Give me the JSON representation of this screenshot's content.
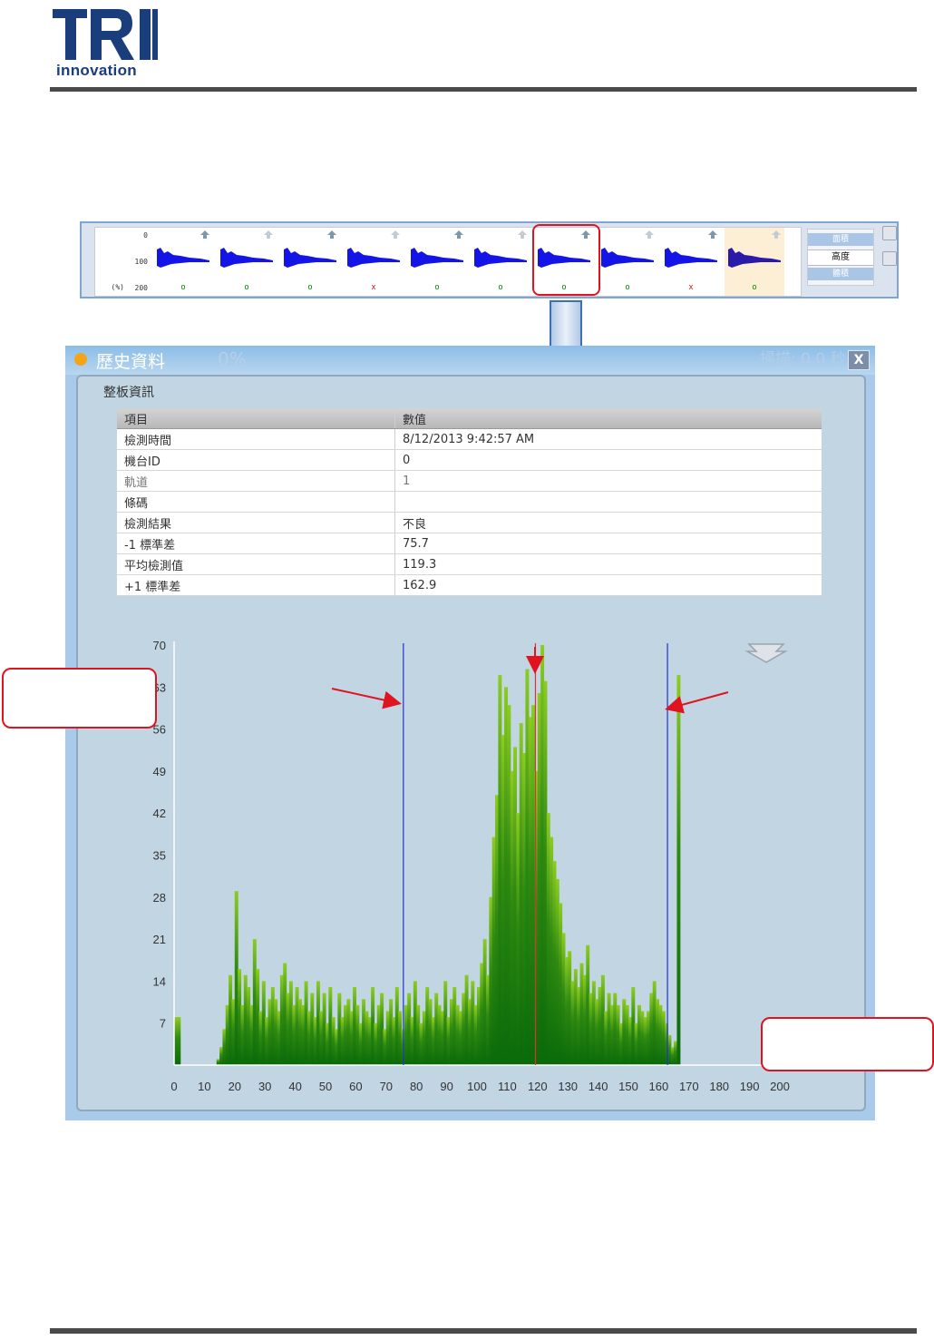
{
  "logo": {
    "brand": "TRI",
    "tagline": "innovation"
  },
  "strip": {
    "y_labels": [
      "0",
      "100",
      "(%)",
      "200"
    ],
    "thumbs": [
      {
        "mark": "o",
        "result": "ok"
      },
      {
        "mark": "o",
        "result": "ok"
      },
      {
        "mark": "o",
        "result": "ok"
      },
      {
        "mark": "x",
        "result": "ng"
      },
      {
        "mark": "o",
        "result": "ok"
      },
      {
        "mark": "o",
        "result": "ok"
      },
      {
        "mark": "o",
        "result": "ok"
      },
      {
        "mark": "o",
        "result": "ok"
      },
      {
        "mark": "x",
        "result": "ng"
      },
      {
        "mark": "o",
        "result": "ok"
      }
    ],
    "side_top": "面積",
    "side_selected": "高度",
    "side_bottom": "體積"
  },
  "window": {
    "title": "歷史資料",
    "ghost_text": "0%",
    "ghost_right": "掃描: 0.0 秒",
    "close_label": "X",
    "panel_title": "整板資訊"
  },
  "table": {
    "headers": [
      "項目",
      "數值"
    ],
    "rows": [
      [
        "檢測時間",
        "8/12/2013 9:42:57 AM"
      ],
      [
        "機台ID",
        "0"
      ],
      [
        "軌道",
        "1"
      ],
      [
        "條碼",
        ""
      ],
      [
        "檢測結果",
        "不良"
      ],
      [
        "-1 標準差",
        "75.7"
      ],
      [
        "平均檢測值",
        "119.3"
      ],
      [
        "+1 標準差",
        "162.9"
      ]
    ]
  },
  "chart_data": {
    "type": "bar",
    "xlim": [
      0,
      200
    ],
    "ylim": [
      0,
      70
    ],
    "xticks": [
      "0",
      "10",
      "20",
      "30",
      "40",
      "50",
      "60",
      "70",
      "80",
      "90",
      "100",
      "110",
      "120",
      "130",
      "140",
      "150",
      "160",
      "170",
      "180",
      "190",
      "200"
    ],
    "yticks": [
      "7",
      "14",
      "21",
      "28",
      "35",
      "42",
      "49",
      "56",
      "63",
      "70"
    ],
    "lines": {
      "minus_1_sd": 75.7,
      "mean": 119.3,
      "plus_1_sd": 162.9
    },
    "bar_color_top": "#8ccc22",
    "bar_color_base": "#0a6a0a",
    "mean_line_color": "#e03030",
    "sd_line_color": "#2233cc",
    "x": [
      0,
      1,
      14,
      15,
      16,
      17,
      18,
      19,
      20,
      21,
      22,
      23,
      24,
      25,
      26,
      27,
      28,
      29,
      30,
      31,
      32,
      33,
      34,
      35,
      36,
      37,
      38,
      39,
      40,
      41,
      42,
      43,
      44,
      45,
      46,
      47,
      48,
      49,
      50,
      51,
      52,
      53,
      54,
      55,
      56,
      57,
      58,
      59,
      60,
      61,
      62,
      63,
      64,
      65,
      66,
      67,
      68,
      69,
      70,
      71,
      72,
      73,
      74,
      75,
      76,
      77,
      78,
      79,
      80,
      81,
      82,
      83,
      84,
      85,
      86,
      87,
      88,
      89,
      90,
      91,
      92,
      93,
      94,
      95,
      96,
      97,
      98,
      99,
      100,
      101,
      102,
      103,
      104,
      105,
      106,
      107,
      108,
      109,
      110,
      111,
      112,
      113,
      114,
      115,
      116,
      117,
      118,
      119,
      120,
      121,
      122,
      123,
      124,
      125,
      126,
      127,
      128,
      129,
      130,
      131,
      132,
      133,
      134,
      135,
      136,
      137,
      138,
      139,
      140,
      141,
      142,
      143,
      144,
      145,
      146,
      147,
      148,
      149,
      150,
      151,
      152,
      153,
      154,
      155,
      156,
      157,
      158,
      159,
      160,
      161,
      162,
      163,
      164,
      165,
      166,
      167,
      168,
      169,
      170,
      171,
      172,
      173,
      174,
      175,
      176,
      177,
      178,
      179,
      180,
      181,
      182,
      183,
      184,
      185,
      186,
      187,
      188,
      189,
      190,
      191,
      192,
      193,
      194,
      195,
      196,
      197,
      198,
      199,
      200
    ],
    "values": [
      8,
      8,
      1,
      3,
      6,
      10,
      15,
      11,
      29,
      16,
      10,
      15,
      13,
      10,
      21,
      16,
      9,
      14,
      8,
      11,
      13,
      11,
      9,
      15,
      17,
      12,
      14,
      10,
      13,
      11,
      10,
      14,
      9,
      12,
      8,
      14,
      9,
      12,
      7,
      13,
      8,
      6,
      12,
      8,
      10,
      11,
      9,
      13,
      10,
      7,
      11,
      9,
      8,
      13,
      7,
      10,
      12,
      6,
      9,
      11,
      8,
      13,
      9,
      6,
      10,
      12,
      8,
      14,
      10,
      7,
      9,
      13,
      11,
      8,
      12,
      10,
      9,
      14,
      8,
      11,
      13,
      10,
      9,
      12,
      15,
      11,
      14,
      10,
      13,
      17,
      21,
      15,
      28,
      38,
      45,
      65,
      55,
      63,
      60,
      49,
      53,
      42,
      57,
      52,
      66,
      58,
      60,
      49,
      62,
      70,
      64,
      42,
      38,
      34,
      31,
      27,
      22,
      18,
      19,
      14,
      16,
      13,
      17,
      15,
      20,
      12,
      14,
      11,
      13,
      15,
      9,
      12,
      10,
      12,
      10,
      7,
      11,
      10,
      8,
      13,
      7,
      10,
      9,
      8,
      9,
      12,
      14,
      11,
      10,
      9,
      7,
      5,
      3,
      4,
      65
    ]
  }
}
